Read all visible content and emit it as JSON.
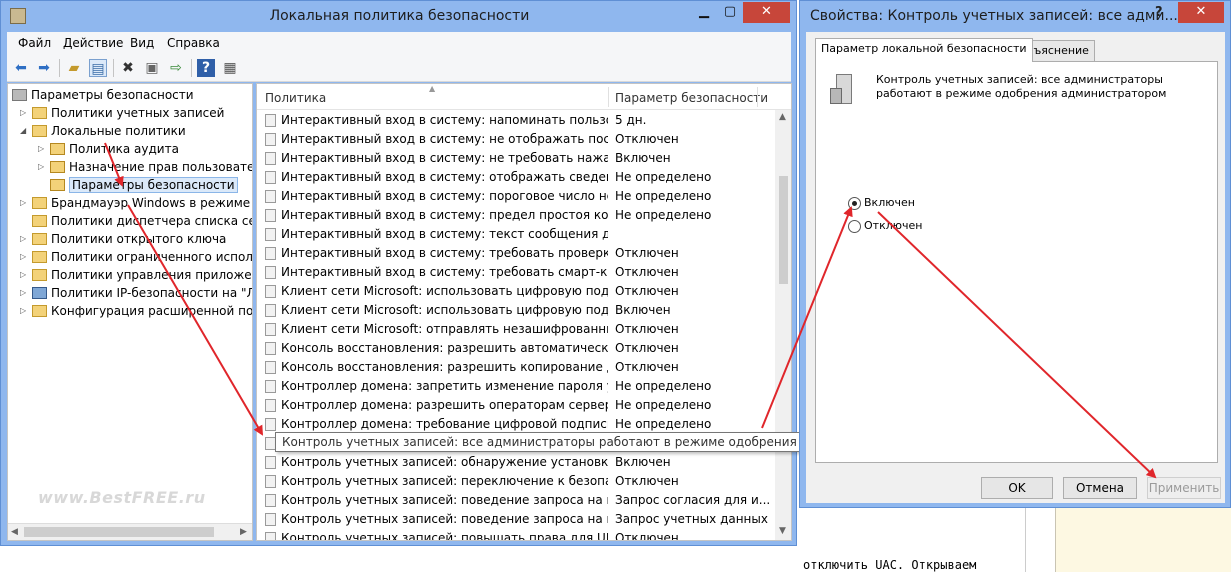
{
  "main_window": {
    "title": "Локальная политика безопасности",
    "menu": [
      "Файл",
      "Действие",
      "Вид",
      "Справка"
    ]
  },
  "toolbar_icons": [
    "back-icon",
    "forward-icon",
    "up-folder-icon",
    "show-tree-icon",
    "delete-icon",
    "properties-icon",
    "export-icon",
    "help-icon",
    "view-icon"
  ],
  "tree": {
    "items": [
      {
        "label": "Параметры безопасности",
        "level": 0,
        "expander": "",
        "icon": "root"
      },
      {
        "label": "Политики учетных записей",
        "level": 1,
        "expander": "▷",
        "icon": "folder"
      },
      {
        "label": "Локальные политики",
        "level": 1,
        "expander": "◢",
        "icon": "folder"
      },
      {
        "label": "Политика аудита",
        "level": 2,
        "expander": "▷",
        "icon": "lock"
      },
      {
        "label": "Назначение прав пользователя",
        "level": 2,
        "expander": "▷",
        "icon": "lock"
      },
      {
        "label": "Параметры безопасности",
        "level": 2,
        "expander": "",
        "icon": "lock",
        "selected": true
      },
      {
        "label": "Брандмауэр Windows в режиме пов",
        "level": 1,
        "expander": "▷",
        "icon": "folder"
      },
      {
        "label": "Политики диспетчера списка сетей",
        "level": 1,
        "expander": "",
        "icon": "folder"
      },
      {
        "label": "Политики открытого ключа",
        "level": 1,
        "expander": "▷",
        "icon": "folder"
      },
      {
        "label": "Политики ограниченного использо",
        "level": 1,
        "expander": "▷",
        "icon": "folder"
      },
      {
        "label": "Политики управления приложения",
        "level": 1,
        "expander": "▷",
        "icon": "folder"
      },
      {
        "label": "Политики IP-безопасности на \"Лока",
        "level": 1,
        "expander": "▷",
        "icon": "monitor"
      },
      {
        "label": "Конфигурация расширенной полит",
        "level": 1,
        "expander": "▷",
        "icon": "folder"
      }
    ]
  },
  "list": {
    "headers": {
      "policy": "Политика",
      "setting": "Параметр безопасности"
    },
    "rows": [
      {
        "policy": "Интерактивный вход в систему: напоминать пользовател...",
        "setting": "5 дн."
      },
      {
        "policy": "Интерактивный вход в систему: не отображать последне...",
        "setting": "Отключен"
      },
      {
        "policy": "Интерактивный вход в систему: не требовать нажатия СТ...",
        "setting": "Включен"
      },
      {
        "policy": "Интерактивный вход в систему: отображать сведения о п...",
        "setting": "Не определено"
      },
      {
        "policy": "Интерактивный вход в систему: пороговое число неудач...",
        "setting": "Не определено"
      },
      {
        "policy": "Интерактивный вход в систему: предел простоя компьют...",
        "setting": "Не определено"
      },
      {
        "policy": "Интерактивный вход в систему: текст сообщения для по...",
        "setting": ""
      },
      {
        "policy": "Интерактивный вход в систему: требовать проверки на к...",
        "setting": "Отключен"
      },
      {
        "policy": "Интерактивный вход в систему: требовать смарт-карту",
        "setting": "Отключен"
      },
      {
        "policy": "Клиент сети Microsoft: использовать цифровую подпись ...",
        "setting": "Отключен"
      },
      {
        "policy": "Клиент сети Microsoft: использовать цифровую подпись ...",
        "setting": "Включен"
      },
      {
        "policy": "Клиент сети Microsoft: отправлять незашифрованный па...",
        "setting": "Отключен"
      },
      {
        "policy": "Консоль восстановления: разрешить автоматический вх...",
        "setting": "Отключен"
      },
      {
        "policy": "Консоль восстановления: разрешить копирование диске...",
        "setting": "Отключен"
      },
      {
        "policy": "Контроллер домена: запретить изменение пароля учетн...",
        "setting": "Не определено"
      },
      {
        "policy": "Контроллер домена: разрешить операторам сервера зад...",
        "setting": "Не определено"
      },
      {
        "policy": "Контроллер домена: требование цифровой подписи для ...",
        "setting": "Не определено"
      },
      {
        "policy": "Контроль учетных записей: все администраторы работают в режиме одобрения администратором",
        "setting": ""
      },
      {
        "policy": "Контроль учетных записей: обнаружение установки при...",
        "setting": "Включен"
      },
      {
        "policy": "Контроль учетных записей: переключение к безопасном...",
        "setting": "Отключен"
      },
      {
        "policy": "Контроль учетных записей: поведение запроса на повы...",
        "setting": "Запрос согласия для и..."
      },
      {
        "policy": "Контроль учетных записей: поведение запроса на повы...",
        "setting": "Запрос учетных данных"
      },
      {
        "policy": "Контроль учетных записей: повышать права для UIAcces...",
        "setting": "Отключен"
      }
    ],
    "tooltip": "Контроль учетных записей: все администраторы работают в режиме одобрения администратором"
  },
  "watermark": "www.BestFREE.ru",
  "dialog": {
    "title": "Свойства: Контроль учетных записей: все адми...",
    "help_label": "?",
    "tabs": [
      "Параметр локальной безопасности",
      "Объяснение"
    ],
    "description": "Контроль учетных записей: все администраторы работают в режиме одобрения администратором",
    "options": [
      {
        "label": "Включен",
        "checked": true
      },
      {
        "label": "Отключен",
        "checked": false
      }
    ],
    "buttons": {
      "ok": "OK",
      "cancel": "Отмена",
      "apply": "Применить"
    }
  },
  "background_text": "отключить UAC. Открываем",
  "accent_colors": {
    "titlebar": "#8fb7ee",
    "close": "#c7463a",
    "arrow": "#e0262b"
  }
}
